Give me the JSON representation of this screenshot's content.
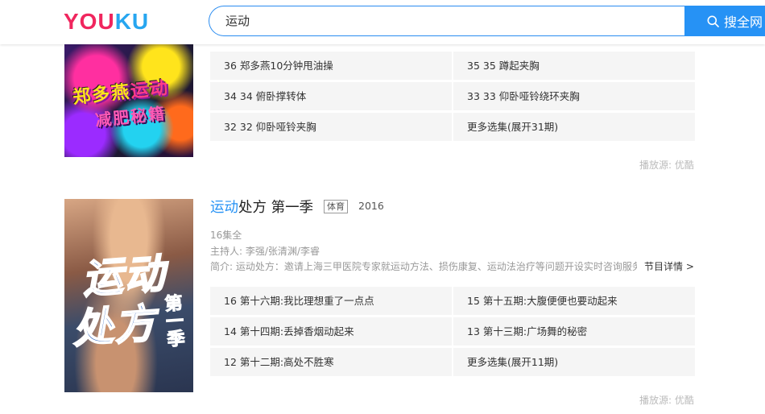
{
  "header": {
    "logo_part1": "YOU",
    "logo_part2": "KU",
    "search_value": "运动",
    "search_button": "搜全网"
  },
  "show1": {
    "poster_line1_a": "郑多燕",
    "poster_line1_b": "运动",
    "poster_line2": "减肥秘籍",
    "episodes": [
      "36 郑多燕10分钟甩油操",
      "35 35 蹲起夹胸",
      "34 34 俯卧撑转体",
      "33 33 仰卧哑铃绕环夹胸",
      "32 32 仰卧哑铃夹胸",
      "更多选集(展开31期)"
    ],
    "source": "播放源: 优酷"
  },
  "show2": {
    "title_highlight": "运动",
    "title_rest": "处方 第一季",
    "tag": "体育",
    "year": "2016",
    "episode_count": "16集全",
    "hosts": "主持人:  李强/张清渊/李睿",
    "description": "简介:  运动处方：邀请上海三甲医院专家就运动方法、损伤康复、运动法治疗等问题开设实时咨询服务",
    "detail_link": "节目详情 >",
    "poster_line1": "运动",
    "poster_line2": "处方",
    "poster_side": "第一季",
    "episodes": [
      "16 第十六期:我比理想重了一点点",
      "15 第十五期:大腹便便也要动起来",
      "14 第十四期:丢掉香烟动起来",
      "13 第十三期:广场舞的秘密",
      "12 第十二期:高处不胜寒",
      "更多选集(展开11期)"
    ],
    "source": "播放源: 优酷"
  }
}
